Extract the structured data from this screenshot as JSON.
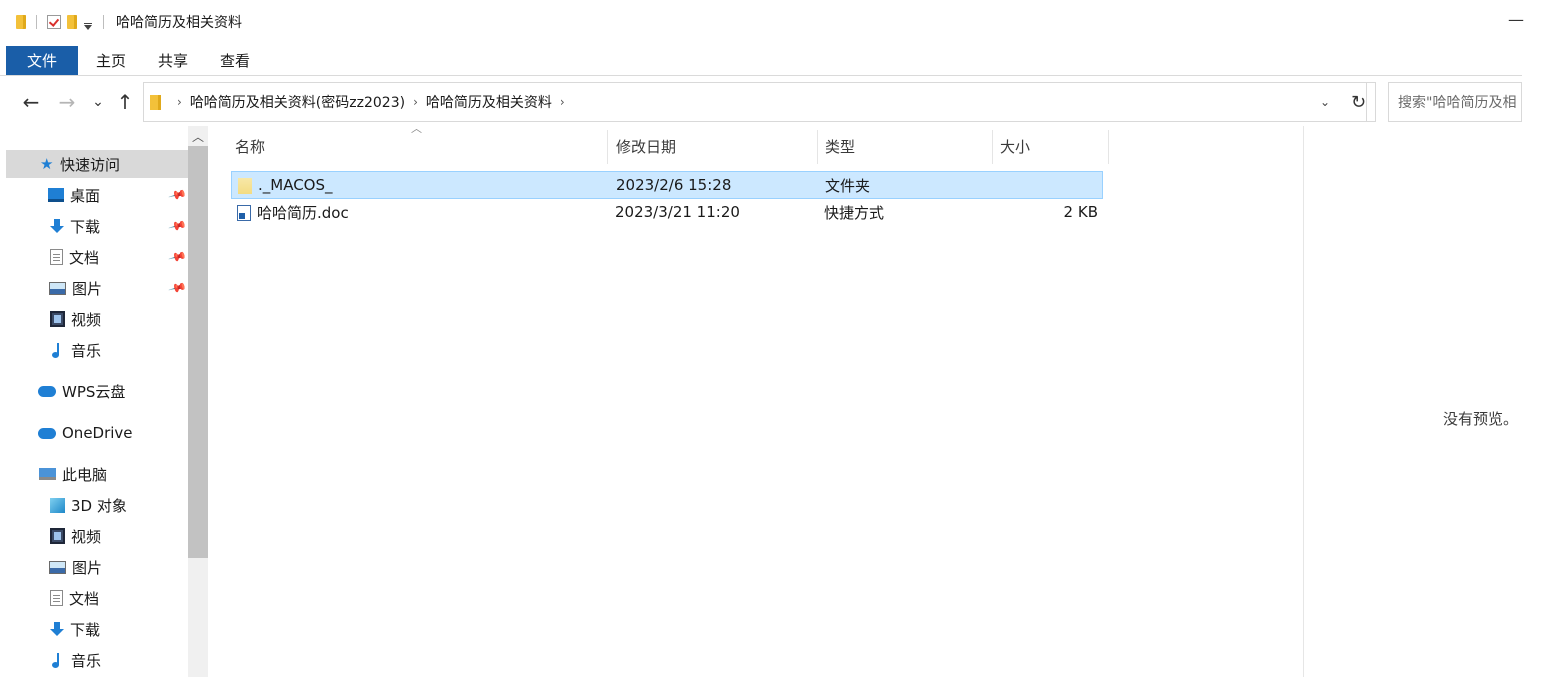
{
  "window": {
    "title": "哈哈简历及相关资料",
    "minimize_glyph": "—"
  },
  "ribbon": {
    "tabs": [
      "文件",
      "主页",
      "共享",
      "查看"
    ]
  },
  "address": {
    "crumbs": [
      "哈哈简历及相关资料(密码zz2023)",
      "哈哈简历及相关资料"
    ],
    "separator": "›",
    "search_placeholder": "搜索\"哈哈简历及相"
  },
  "nav": {
    "back": "←",
    "forward": "→",
    "recent": "⌄",
    "up": "↑",
    "refresh": "↻",
    "addr_dropdown": "⌄"
  },
  "sidebar": {
    "quick_access": "快速访问",
    "quick_items": [
      {
        "label": "桌面",
        "icon": "desktop-icon",
        "pinned": true
      },
      {
        "label": "下载",
        "icon": "download-icon",
        "pinned": true
      },
      {
        "label": "文档",
        "icon": "document-icon",
        "pinned": true
      },
      {
        "label": "图片",
        "icon": "pictures-icon",
        "pinned": true
      },
      {
        "label": "视频",
        "icon": "videos-icon",
        "pinned": false
      },
      {
        "label": "音乐",
        "icon": "music-icon",
        "pinned": false
      }
    ],
    "wps": "WPS云盘",
    "onedrive": "OneDrive",
    "this_pc": "此电脑",
    "pc_items": [
      {
        "label": "3D 对象",
        "icon": "3d-objects-icon"
      },
      {
        "label": "视频",
        "icon": "videos-icon"
      },
      {
        "label": "图片",
        "icon": "pictures-icon"
      },
      {
        "label": "文档",
        "icon": "document-icon"
      },
      {
        "label": "下载",
        "icon": "download-icon"
      },
      {
        "label": "音乐",
        "icon": "music-icon"
      }
    ]
  },
  "filelist": {
    "columns": {
      "name": "名称",
      "date": "修改日期",
      "type": "类型",
      "size": "大小"
    },
    "rows": [
      {
        "name": "._MACOS_",
        "date": "2023/2/6 15:28",
        "type": "文件夹",
        "size": "",
        "icon": "folder-icon",
        "selected": true
      },
      {
        "name": "哈哈简历.doc",
        "date": "2023/3/21 11:20",
        "type": "快捷方式",
        "size": "2 KB",
        "icon": "shortcut-doc-icon",
        "selected": false
      }
    ]
  },
  "preview": {
    "text": "没有预览。"
  }
}
